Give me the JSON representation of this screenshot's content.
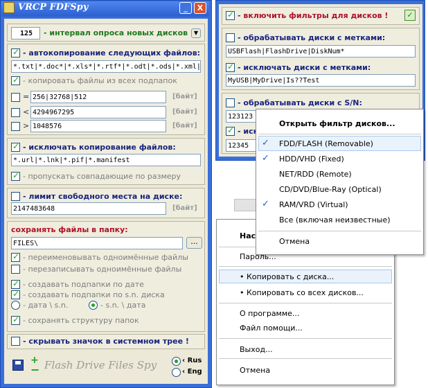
{
  "main_window": {
    "title": "VRCP  FDFSpy",
    "btn_min": "_",
    "btn_close": "X",
    "interval": {
      "value": "125",
      "label": "- интервал опроса новых дисков",
      "dropdown": "▼"
    },
    "autocopy": {
      "checked": true,
      "label": "- автокопирование следующих файлов:",
      "value": "*.txt|*.doc*|*.xls*|*.rtf*|*.odt|*.ods|*.xml|"
    },
    "copy_sub": {
      "checked": true,
      "label": "- копировать файлы из всех подпапок"
    },
    "size_rows": [
      {
        "sym": "=",
        "value": "256|32768|512",
        "unit": "[байт]"
      },
      {
        "sym": "<",
        "value": "4294967295",
        "unit": "[байт]"
      },
      {
        "sym": ">",
        "value": "1048576",
        "unit": "[байт]"
      }
    ],
    "exclude": {
      "checked": true,
      "label": "- исключать копирование файлов:",
      "value": "*.url|*.lnk|*.pif|*.manifest"
    },
    "skip_same": {
      "checked": true,
      "label": "- пропускать совпадающие по размеру"
    },
    "limit": {
      "checked": false,
      "label": "- лимит свободного места на диске:",
      "value": "2147483648",
      "unit": "[байт]"
    },
    "save_to": {
      "label": "сохранять файлы в папку:",
      "value": "FILES\\",
      "browse": "..."
    },
    "options": [
      {
        "checked": true,
        "label": "- переименовывать одноимённые файлы"
      },
      {
        "checked": false,
        "label": "- перезаписывать одноимённые файлы"
      },
      {
        "checked": true,
        "label": "- создавать подпапки по дате"
      },
      {
        "checked": true,
        "label": "- создавать подпапки по s.n. диска"
      }
    ],
    "radio_date_sn": "- дата \\ s.n.",
    "radio_sn_date": "- s.n. \\ дата",
    "keep_tree": {
      "checked": true,
      "label": "- сохранять структуру папок"
    },
    "hide_tray": {
      "checked": false,
      "label": "- скрывать значок в системном трее !"
    },
    "logo_text": "Flash Drive Files Spy",
    "lang_ru": "Rus",
    "lang_en": "Eng"
  },
  "filter_window": {
    "enable": {
      "checked": true,
      "label": "- включить фильтры для дисков !"
    },
    "labels_process": {
      "checked": false,
      "label": "- обрабатывать диски с метками:",
      "value": "USBFlash|FlashDrive|DiskNum*"
    },
    "labels_exclude": {
      "checked": true,
      "label": "- исключать диски с метками:",
      "value": "MyUSB|MyDrive|Is??Test"
    },
    "sn_process": {
      "checked": false,
      "label": "- обрабатывать диски с S/N:",
      "value": "123123"
    },
    "sn_exclude": {
      "checked": true,
      "label": "- иск",
      "value": "12345"
    }
  },
  "tray_menu": {
    "items": [
      "Нас",
      "Пароль...",
      "• Копировать с диска...",
      "• Копировать со всех дисков...",
      "О программе...",
      "Файл помощи...",
      "Выход...",
      "Отмена"
    ]
  },
  "filter_menu": {
    "title": "Открыть фильтр дисков...",
    "items": [
      {
        "checked": true,
        "label": "FDD/FLASH  (Removable)"
      },
      {
        "checked": true,
        "label": "HDD/VHD  (Fixed)"
      },
      {
        "checked": false,
        "label": "NET/RDD  (Remote)"
      },
      {
        "checked": false,
        "label": "CD/DVD/Blue-Ray  (Optical)"
      },
      {
        "checked": true,
        "label": "RAM/VRD  (Virtual)"
      },
      {
        "checked": false,
        "label": "Все  (включая неизвестные)"
      }
    ],
    "cancel": "Отмена"
  }
}
